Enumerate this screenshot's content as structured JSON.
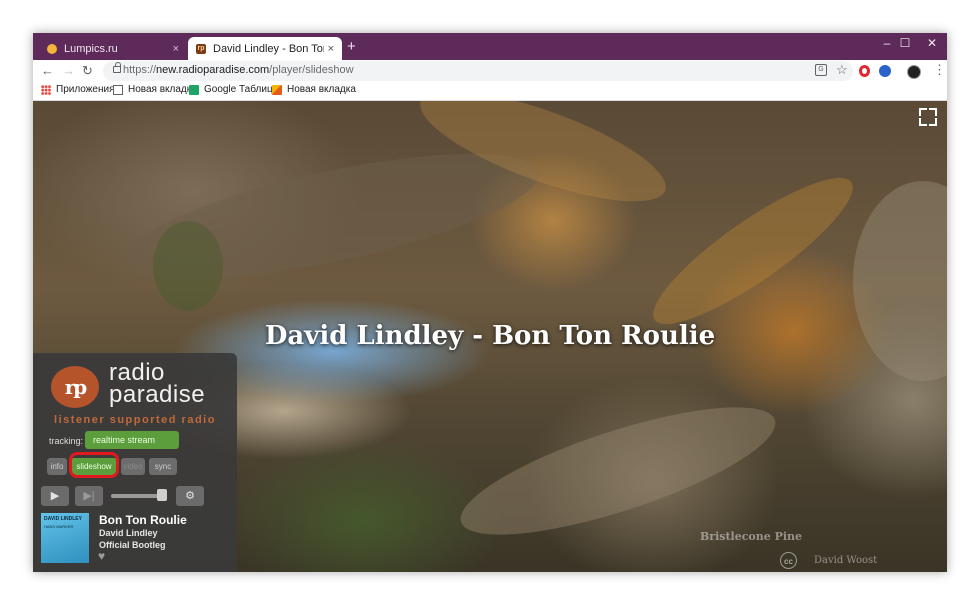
{
  "browser": {
    "tabs": [
      {
        "title": "Lumpics.ru",
        "close": "×"
      },
      {
        "title": "David Lindley - Bon Ton Roulie",
        "close": "×"
      }
    ],
    "new_tab": "+",
    "window_controls": {
      "minimize": "–",
      "maximize": "☐",
      "close": "✕"
    },
    "nav": {
      "back": "←",
      "forward": "→",
      "reload": "↻"
    },
    "url": {
      "scheme": "https://",
      "host": "new.radioparadise.com",
      "path": "/player/slideshow"
    },
    "bookmarks": [
      "Приложения",
      "Новая вкладка",
      "Google Таблицы",
      "Новая вкладка"
    ]
  },
  "page": {
    "song_title": "David Lindley - Bon Ton Roulie",
    "photo_caption": "Bristlecone Pine",
    "photo_credit_symbol": "cc",
    "photo_credit": "David Woost"
  },
  "player": {
    "logo_initials": "rp",
    "logo_line1": "radio",
    "logo_line2": "paradise",
    "tagline": "listener supported radio",
    "tracking_label": "tracking:",
    "stream": "realtime stream",
    "tabs": [
      "info",
      "slideshow",
      "video",
      "sync"
    ],
    "play_icon": "▶",
    "skip_icon": "▶|",
    "settings_icon": "⚙",
    "volume": 0.85,
    "cover_line1": "DAVID LINDLEY",
    "cover_line2": "HANS MARKER",
    "now_playing": {
      "title": "Bon Ton Roulie",
      "artist": "David Lindley",
      "album": "Official Bootleg"
    },
    "heart_icon": "♥"
  },
  "colors": {
    "titlebar": "#5d2a59",
    "panel": "#3a3a3a",
    "accent_green": "#5c9e3c",
    "brand_orange": "#c06a3c",
    "highlight_red": "#e1191f"
  }
}
